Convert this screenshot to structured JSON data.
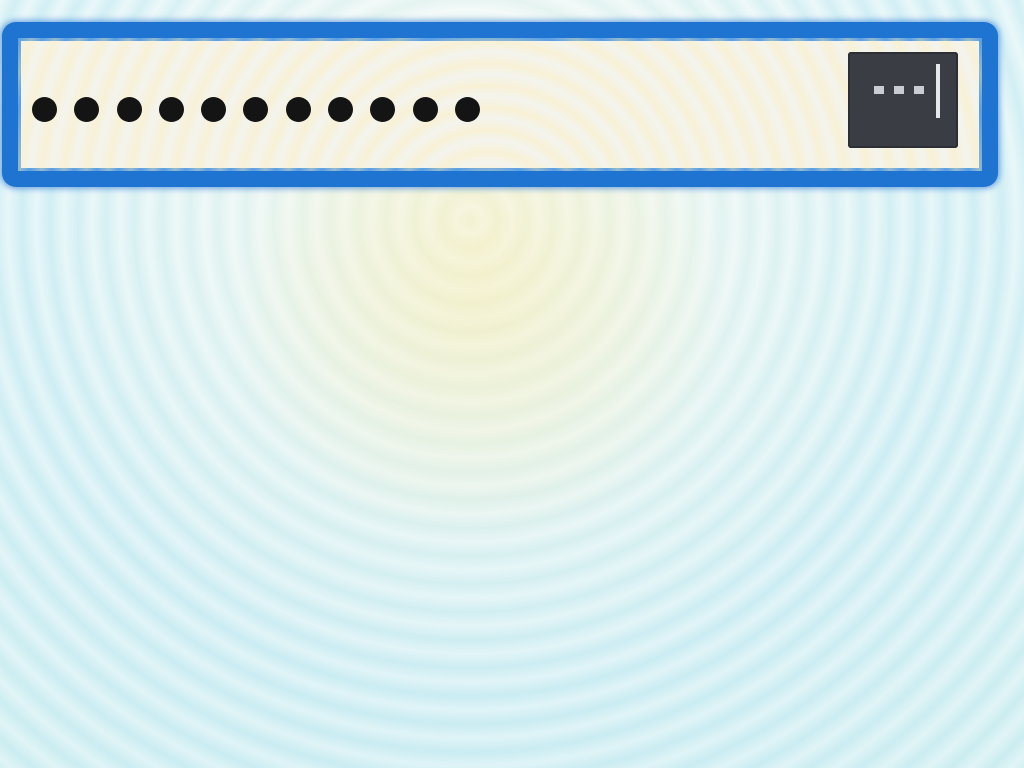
{
  "password_field": {
    "masked_length": 11,
    "mask_char": "●",
    "focused": true
  },
  "reveal_button": {
    "icon": "ellipsis-icon"
  },
  "colors": {
    "focus_ring": "#1f74d2",
    "field_background": "#f4f4ee",
    "button_background": "#3a3d44",
    "mask_dot": "#141414"
  }
}
